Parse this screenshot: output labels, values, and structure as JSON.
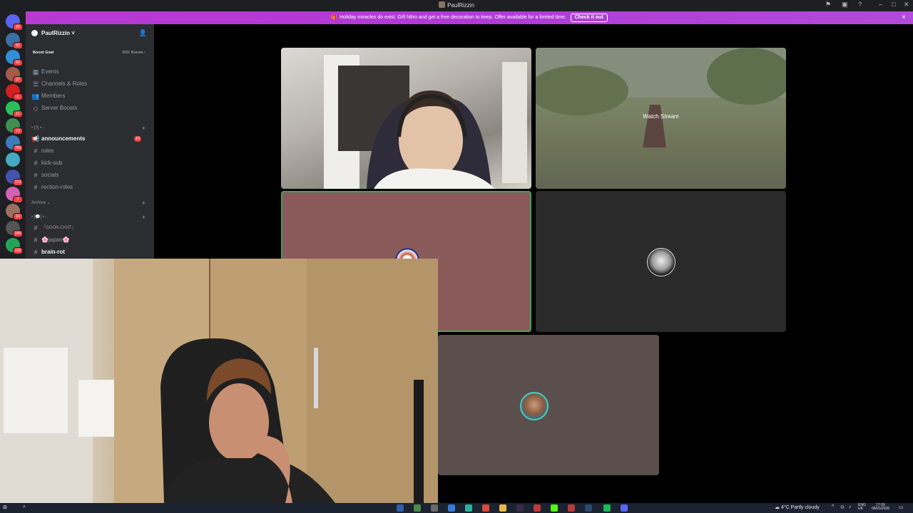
{
  "window": {
    "title": "PaulRizzin",
    "controls": [
      "minimize-icon",
      "maximize-icon",
      "close-icon"
    ]
  },
  "banner": {
    "message": "Holiday miracles do exist. Gift Nitro and get a free decoration to keep. Offer available for a limited time.",
    "cta": "Check it out",
    "close": "×"
  },
  "server_rail": {
    "home_badge": "20",
    "badges": [
      "62",
      "66",
      "37",
      "1",
      "11",
      "70",
      "766",
      "173",
      "2",
      "10",
      "244",
      "130"
    ]
  },
  "sidebar": {
    "server_name": "PaulRizzin",
    "chevron": "˅",
    "boost_goal": {
      "label": "Boost Goal",
      "progress": "0/31 Boosts ›"
    },
    "top_items": [
      {
        "label": "Events",
        "icon": "calendar-icon"
      },
      {
        "label": "Channels & Roles",
        "icon": "list-icon"
      },
      {
        "label": "Members",
        "icon": "members-icon"
      },
      {
        "label": "Server Boosts",
        "icon": "boost-icon"
      }
    ],
    "category1": "• [?] • -",
    "channels1": [
      {
        "label": "announcements",
        "unread": true,
        "badge": "62",
        "icon": "megaphone-icon"
      },
      {
        "label": "rules"
      },
      {
        "label": "kick-sub"
      },
      {
        "label": "socials"
      },
      {
        "label": "rection-roles"
      }
    ],
    "category_archive": "Archive ⌄",
    "category2": "• [💬] • -",
    "channels2": [
      {
        "label": "「GOON-CHAT」"
      },
      {
        "label": "🌸japan🌸"
      },
      {
        "label": "brain-rot",
        "unread": true
      }
    ]
  },
  "stage": {
    "watch_stream": "Watch Stream"
  },
  "taskbar": {
    "weather": "4°C  Partly cloudy",
    "lang": "ENG",
    "region": "UK",
    "time": "17:09",
    "date": "06/01/2026"
  }
}
